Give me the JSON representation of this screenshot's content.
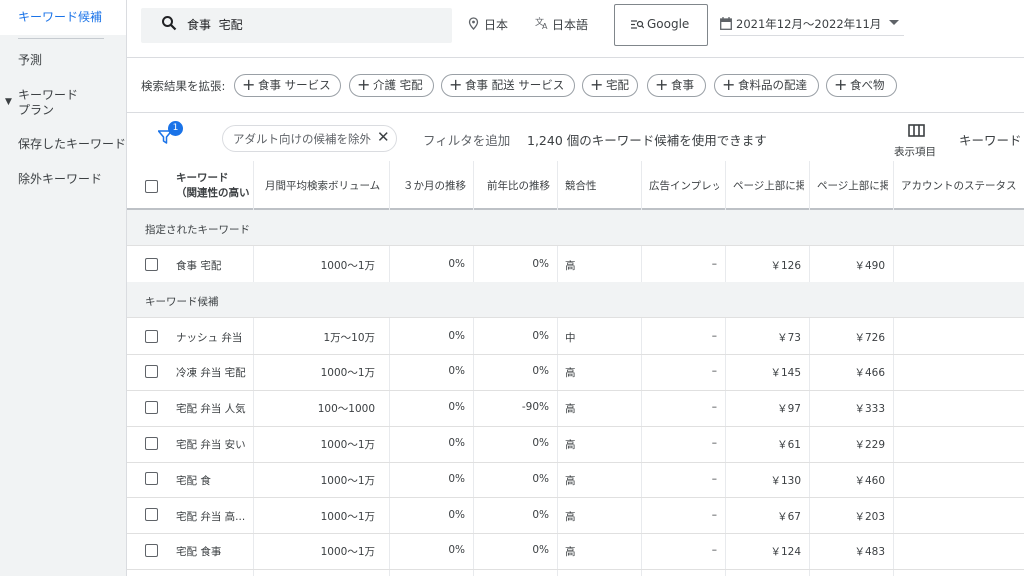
{
  "sidebar": {
    "items": [
      {
        "label": "キーワード候補",
        "active": true
      },
      {
        "label": "予測"
      },
      {
        "label": "キーワード\nプラン"
      },
      {
        "label": "保存したキーワード"
      },
      {
        "label": "除外キーワード"
      }
    ],
    "plan_line1": "キーワード",
    "plan_line2": "プラン"
  },
  "topbar": {
    "search_value": "食事  宅配",
    "location": "日本",
    "language": "日本語",
    "network": "Google",
    "date_range": "2021年12月〜2022年11月"
  },
  "expand": {
    "label": "検索結果を拡張:",
    "chips": [
      "食事 サービス",
      "介護 宅配",
      "食事 配送 サービス",
      "宅配",
      "食事",
      "食料品の配達",
      "食べ物"
    ]
  },
  "filter": {
    "badge": "1",
    "chip_text": "アダルト向けの候補を除外",
    "add_filter": "フィルタを追加",
    "count_text": "1,240 個のキーワード候補を使用できます",
    "columns_label": "表示項目",
    "keyword_button": "キーワード"
  },
  "table": {
    "headers": {
      "keyword": "キーワード",
      "keyword_sub": "（関連性の高い",
      "volume": "月間平均検索ボリューム",
      "three_month": "３か月の推移",
      "yoy": "前年比の推移",
      "competition": "競合性",
      "impression": "広告インプレッ",
      "top_low": "ページ上部に掲",
      "top_high": "ページ上部に掲",
      "status": "アカウントのステータス"
    },
    "section_specified": "指定されたキーワード",
    "section_ideas": "キーワード候補",
    "specified_rows": [
      {
        "keyword": "食事 宅配",
        "volume": "1000～1万",
        "three_month": "0%",
        "yoy": "0%",
        "competition": "高",
        "impression": "–",
        "top_low": "￥126",
        "top_high": "￥490"
      }
    ],
    "idea_rows": [
      {
        "keyword": "ナッシュ 弁当",
        "volume": "1万～10万",
        "three_month": "0%",
        "yoy": "0%",
        "competition": "中",
        "impression": "–",
        "top_low": "￥73",
        "top_high": "￥726"
      },
      {
        "keyword": "冷凍 弁当 宅配",
        "volume": "1000～1万",
        "three_month": "0%",
        "yoy": "0%",
        "competition": "高",
        "impression": "–",
        "top_low": "￥145",
        "top_high": "￥466"
      },
      {
        "keyword": "宅配 弁当 人気",
        "volume": "100～1000",
        "three_month": "0%",
        "yoy": "-90%",
        "competition": "高",
        "impression": "–",
        "top_low": "￥97",
        "top_high": "￥333"
      },
      {
        "keyword": "宅配 弁当 安い",
        "volume": "1000～1万",
        "three_month": "0%",
        "yoy": "0%",
        "competition": "高",
        "impression": "–",
        "top_low": "￥61",
        "top_high": "￥229"
      },
      {
        "keyword": "宅配 食",
        "volume": "1000～1万",
        "three_month": "0%",
        "yoy": "0%",
        "competition": "高",
        "impression": "–",
        "top_low": "￥130",
        "top_high": "￥460"
      },
      {
        "keyword": "宅配 弁当 高...",
        "volume": "1000～1万",
        "three_month": "0%",
        "yoy": "0%",
        "competition": "高",
        "impression": "–",
        "top_low": "￥67",
        "top_high": "￥203"
      },
      {
        "keyword": "宅配 食事",
        "volume": "1000～1万",
        "three_month": "0%",
        "yoy": "0%",
        "competition": "高",
        "impression": "–",
        "top_low": "￥124",
        "top_high": "￥483"
      }
    ]
  },
  "colors": {
    "accent": "#1a73e8",
    "sidebar_bg": "#f1f3f4",
    "section_bg": "#f1f3f4"
  }
}
